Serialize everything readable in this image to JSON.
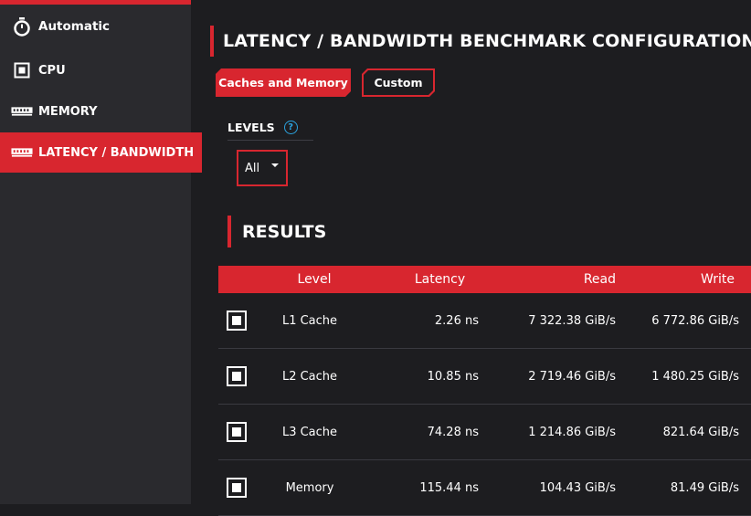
{
  "sidebar": {
    "items": [
      {
        "label": "Automatic",
        "icon": "stopwatch-icon"
      },
      {
        "label": "CPU",
        "icon": "cpu-icon"
      },
      {
        "label": "MEMORY",
        "icon": "memory-icon"
      },
      {
        "label": "LATENCY / BANDWIDTH",
        "icon": "memory-icon",
        "active": true
      }
    ]
  },
  "main": {
    "title": "LATENCY / BANDWIDTH BENCHMARK CONFIGURATION",
    "tabs": [
      {
        "label": "Caches and Memory",
        "active": true
      },
      {
        "label": "Custom",
        "active": false
      }
    ],
    "levels": {
      "label": "LEVELS",
      "help_icon": "help-icon",
      "selected": "All"
    },
    "results_title": "RESULTS",
    "table": {
      "headers": [
        "Level",
        "Latency",
        "Read",
        "Write"
      ],
      "rows": [
        {
          "level": "L1 Cache",
          "latency": "2.26 ns",
          "read": "7 322.38 GiB/s",
          "write": "6 772.86 GiB/s"
        },
        {
          "level": "L2 Cache",
          "latency": "10.85 ns",
          "read": "2 719.46 GiB/s",
          "write": "1 480.25 GiB/s"
        },
        {
          "level": "L3 Cache",
          "latency": "74.28 ns",
          "read": "1 214.86 GiB/s",
          "write": "821.64 GiB/s"
        },
        {
          "level": "Memory",
          "latency": "115.44 ns",
          "read": "104.43 GiB/s",
          "write": "81.49 GiB/s"
        }
      ]
    }
  },
  "colors": {
    "accent": "#d8262f",
    "background": "#1d1d20",
    "sidebar": "#2a2a2e",
    "help": "#2ba3e0"
  }
}
